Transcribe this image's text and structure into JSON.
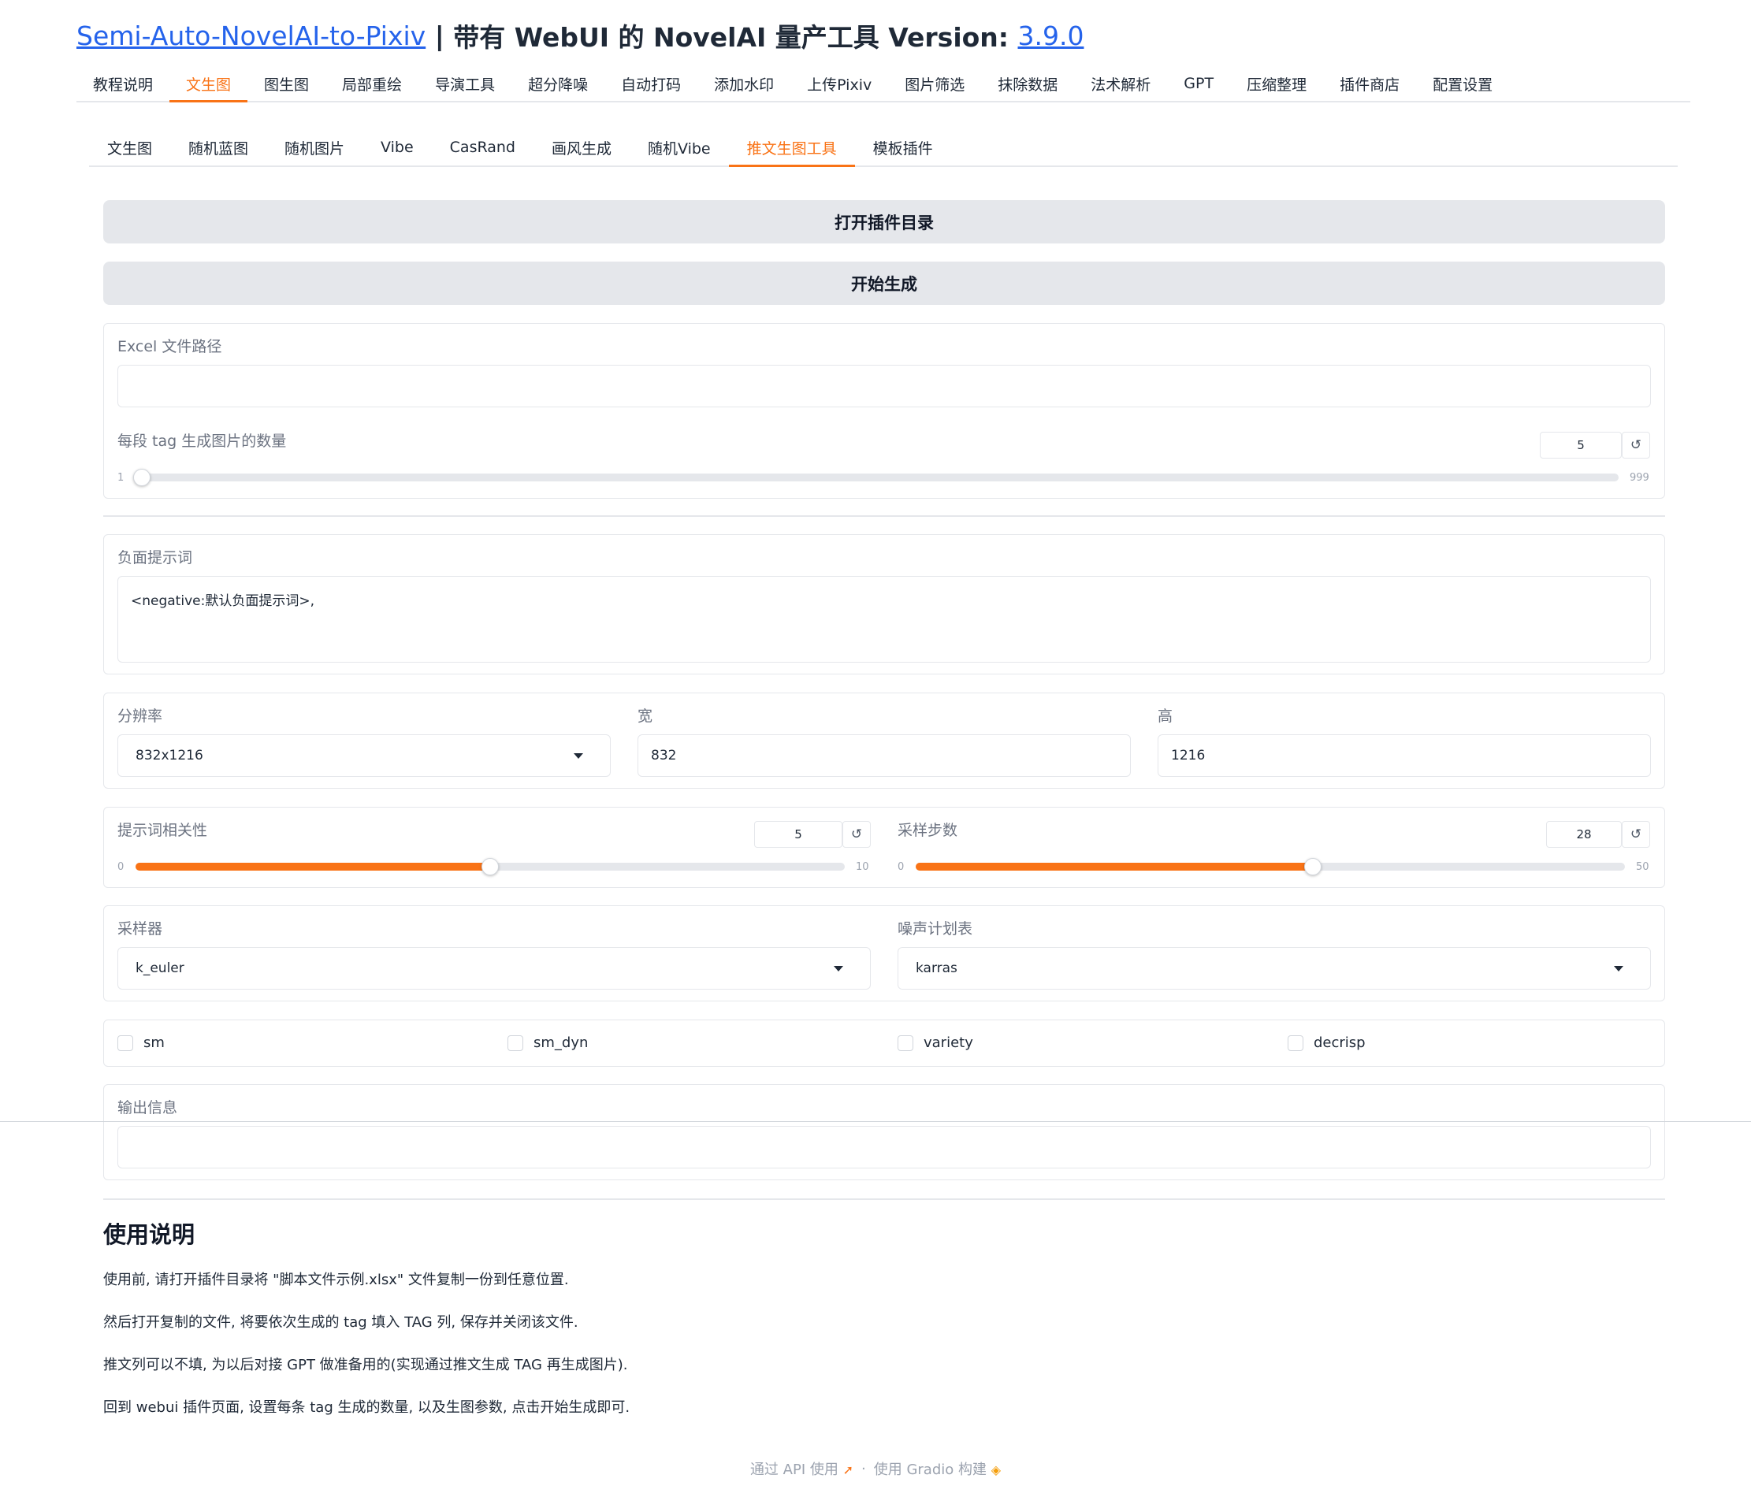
{
  "header": {
    "project_link": "Semi-Auto-NovelAI-to-Pixiv",
    "separator": " | ",
    "subtitle": "带有 WebUI 的 NovelAI 量产工具 Version: ",
    "version": "3.9.0"
  },
  "main_tabs": [
    {
      "label": "教程说明"
    },
    {
      "label": "文生图"
    },
    {
      "label": "图生图"
    },
    {
      "label": "局部重绘"
    },
    {
      "label": "导演工具"
    },
    {
      "label": "超分降噪"
    },
    {
      "label": "自动打码"
    },
    {
      "label": "添加水印"
    },
    {
      "label": "上传Pixiv"
    },
    {
      "label": "图片筛选"
    },
    {
      "label": "抹除数据"
    },
    {
      "label": "法术解析"
    },
    {
      "label": "GPT"
    },
    {
      "label": "压缩整理"
    },
    {
      "label": "插件商店"
    },
    {
      "label": "配置设置"
    }
  ],
  "main_tab_active": "文生图",
  "sub_tabs": [
    {
      "label": "文生图"
    },
    {
      "label": "随机蓝图"
    },
    {
      "label": "随机图片"
    },
    {
      "label": "Vibe"
    },
    {
      "label": "CasRand"
    },
    {
      "label": "画风生成"
    },
    {
      "label": "随机Vibe"
    },
    {
      "label": "推文生图工具"
    },
    {
      "label": "模板插件"
    }
  ],
  "sub_tab_active": "推文生图工具",
  "buttons": {
    "open_plugin_dir": "打开插件目录",
    "start_generate": "开始生成"
  },
  "excel": {
    "label": "Excel 文件路径",
    "value": ""
  },
  "per_tag_count": {
    "label": "每段 tag 生成图片的数量",
    "value": "5",
    "min": "1",
    "max": "999",
    "fraction": 0.004
  },
  "negative": {
    "label": "负面提示词",
    "value": "<negative:默认负面提示词>,"
  },
  "resolution": {
    "label": "分辨率",
    "value": "832x1216",
    "width_label": "宽",
    "width_value": "832",
    "height_label": "高",
    "height_value": "1216"
  },
  "cfg": {
    "label": "提示词相关性",
    "value": "5",
    "min": "0",
    "max": "10",
    "fraction": 0.5
  },
  "steps": {
    "label": "采样步数",
    "value": "28",
    "min": "0",
    "max": "50",
    "fraction": 0.56
  },
  "sampler": {
    "label": "采样器",
    "value": "k_euler"
  },
  "noise_schedule": {
    "label": "噪声计划表",
    "value": "karras"
  },
  "checkboxes": [
    {
      "label": "sm",
      "checked": false
    },
    {
      "label": "sm_dyn",
      "checked": false
    },
    {
      "label": "variety",
      "checked": false
    },
    {
      "label": "decrisp",
      "checked": false
    }
  ],
  "output": {
    "label": "输出信息",
    "value": ""
  },
  "usage": {
    "title": "使用说明",
    "paragraphs": [
      "使用前, 请打开插件目录将 \"脚本文件示例.xlsx\" 文件复制一份到任意位置.",
      "然后打开复制的文件, 将要依次生成的 tag 填入 TAG 列, 保存并关闭该文件.",
      "推文列可以不填, 为以后对接 GPT 做准备用的(实现通过推文生成 TAG 再生成图片).",
      "回到 webui 插件页面, 设置每条 tag 生成的数量, 以及生图参数, 点击开始生成即可."
    ]
  },
  "footer": {
    "api_text": "通过 API 使用",
    "dot": "·",
    "gradio_text": "使用 Gradio 构建",
    "api_icon": "rocket-icon",
    "gradio_icon": "gradio-logo-icon"
  },
  "colors": {
    "accent": "#f97316",
    "link": "#2563eb",
    "border": "#e5e7eb",
    "button_bg": "#e5e7eb"
  }
}
